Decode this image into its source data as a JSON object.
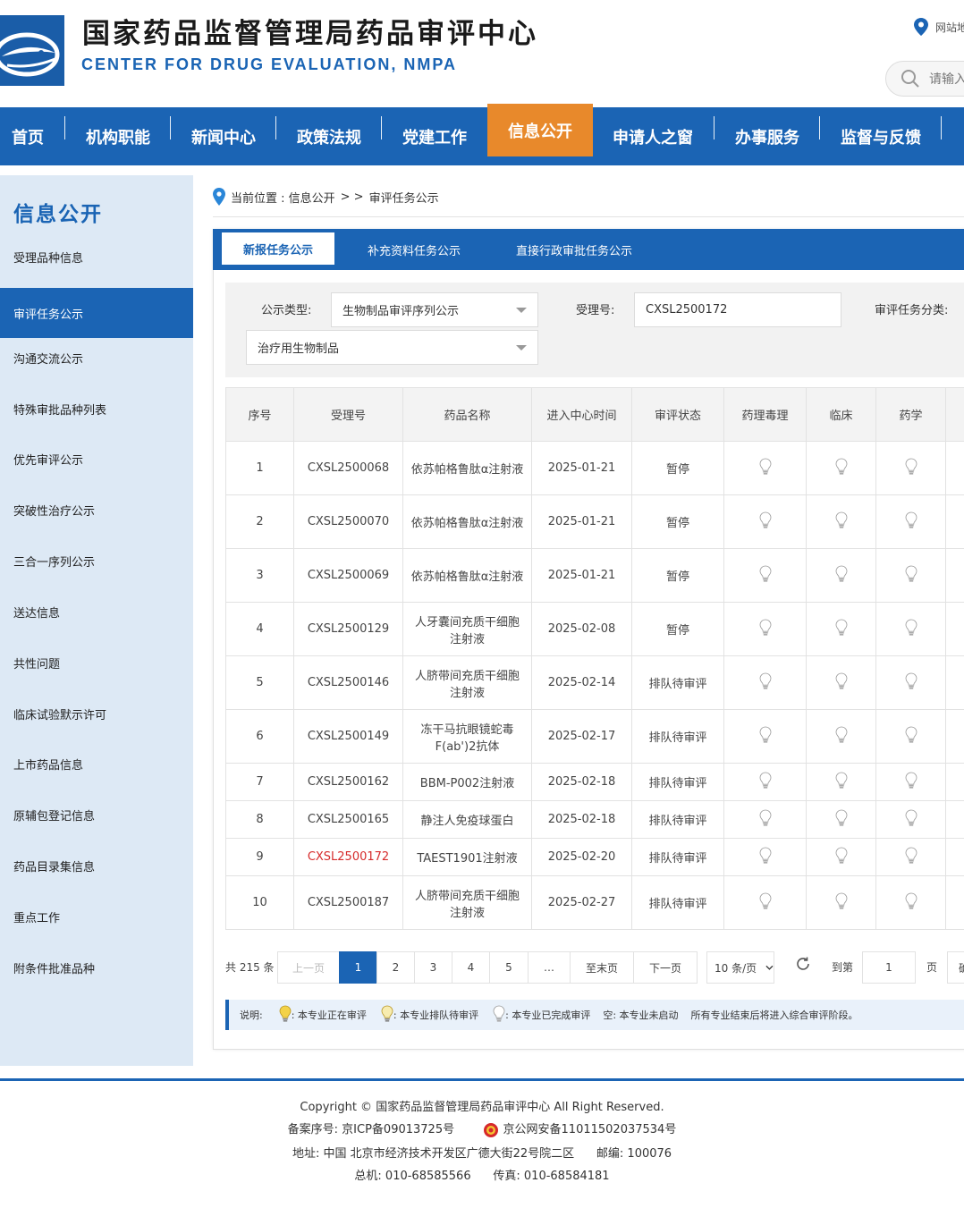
{
  "header": {
    "title": "国家药品监督管理局药品审评中心",
    "subtitle": "CENTER FOR DRUG EVALUATION, NMPA",
    "site_nav": "网站地",
    "search_placeholder": "请输入"
  },
  "nav": {
    "items": [
      "首页",
      "机构职能",
      "新闻中心",
      "政策法规",
      "党建工作",
      "信息公开",
      "申请人之窗",
      "办事服务",
      "监督与反馈"
    ]
  },
  "sidebar": {
    "title": "信息公开",
    "items": [
      "受理品种信息",
      "审评任务公示",
      "沟通交流公示",
      "特殊审批品种列表",
      "优先审评公示",
      "突破性治疗公示",
      "三合一序列公示",
      "送达信息",
      "共性问题",
      "临床试验默示许可",
      "上市药品信息",
      "原辅包登记信息",
      "药品目录集信息",
      "重点工作",
      "附条件批准品种"
    ]
  },
  "breadcrumb": {
    "prefix": "当前位置 : 信息公开",
    "sep": "> >",
    "current": "审评任务公示"
  },
  "tabs": [
    "新报任务公示",
    "补充资料任务公示",
    "直接行政审批任务公示"
  ],
  "filters": {
    "type_label": "公示类型:",
    "type_value": "生物制品审评序列公示",
    "accept_label": "受理号:",
    "accept_value": "CXSL2500172",
    "category_label": "审评任务分类:",
    "category_value": "治疗用生物制品"
  },
  "table": {
    "headers": [
      "序号",
      "受理号",
      "药品名称",
      "进入中心时间",
      "审评状态",
      "药理毒理",
      "临床",
      "药学"
    ],
    "rows": [
      {
        "no": "1",
        "id": "CXSL2500068",
        "name": "依苏帕格鲁肽α注射液",
        "date": "2025-01-21",
        "status": "暂停"
      },
      {
        "no": "2",
        "id": "CXSL2500070",
        "name": "依苏帕格鲁肽α注射液",
        "date": "2025-01-21",
        "status": "暂停"
      },
      {
        "no": "3",
        "id": "CXSL2500069",
        "name": "依苏帕格鲁肽α注射液",
        "date": "2025-01-21",
        "status": "暂停"
      },
      {
        "no": "4",
        "id": "CXSL2500129",
        "name": "人牙囊间充质干细胞注射液",
        "date": "2025-02-08",
        "status": "暂停"
      },
      {
        "no": "5",
        "id": "CXSL2500146",
        "name": "人脐带间充质干细胞注射液",
        "date": "2025-02-14",
        "status": "排队待审评"
      },
      {
        "no": "6",
        "id": "CXSL2500149",
        "name": "冻干马抗眼镜蛇毒F(ab')2抗体",
        "date": "2025-02-17",
        "status": "排队待审评"
      },
      {
        "no": "7",
        "id": "CXSL2500162",
        "name": "BBM-P002注射液",
        "date": "2025-02-18",
        "status": "排队待审评"
      },
      {
        "no": "8",
        "id": "CXSL2500165",
        "name": "静注人免疫球蛋白",
        "date": "2025-02-18",
        "status": "排队待审评"
      },
      {
        "no": "9",
        "id": "CXSL2500172",
        "name": "TAEST1901注射液",
        "date": "2025-02-20",
        "status": "排队待审评"
      },
      {
        "no": "10",
        "id": "CXSL2500187",
        "name": "人脐带间充质干细胞注射液",
        "date": "2025-02-27",
        "status": "排队待审评"
      }
    ]
  },
  "pager": {
    "total": "共 215 条",
    "prev": "上一页",
    "pages": [
      "1",
      "2",
      "3",
      "4",
      "5",
      "…"
    ],
    "last": "至末页",
    "next": "下一页",
    "size": "10 条/页",
    "goto": "到第",
    "goto_value": "1",
    "page_unit": "页",
    "confirm": "确"
  },
  "legend": {
    "label": "说明:",
    "reviewing": "本专业正在审评",
    "queued": "本专业排队待审评",
    "done": "本专业已完成审评",
    "empty": "空: 本专业未启动",
    "note": "所有专业结束后将进入综合审评阶段。"
  },
  "footer": {
    "copyright": "Copyright © 国家药品监督管理局药品审评中心   All Right Reserved.",
    "icp": "备案序号: 京ICP备09013725号",
    "police": "京公网安备11011502037534号",
    "address": "地址: 中国 北京市经济技术开发区广德大街22号院二区      邮编: 100076",
    "phone": "总机: 010-68585566      传真: 010-68584181"
  },
  "colors": {
    "primary": "#1b64b4",
    "accent": "#e8892b",
    "highlight": "#d62b2b"
  }
}
